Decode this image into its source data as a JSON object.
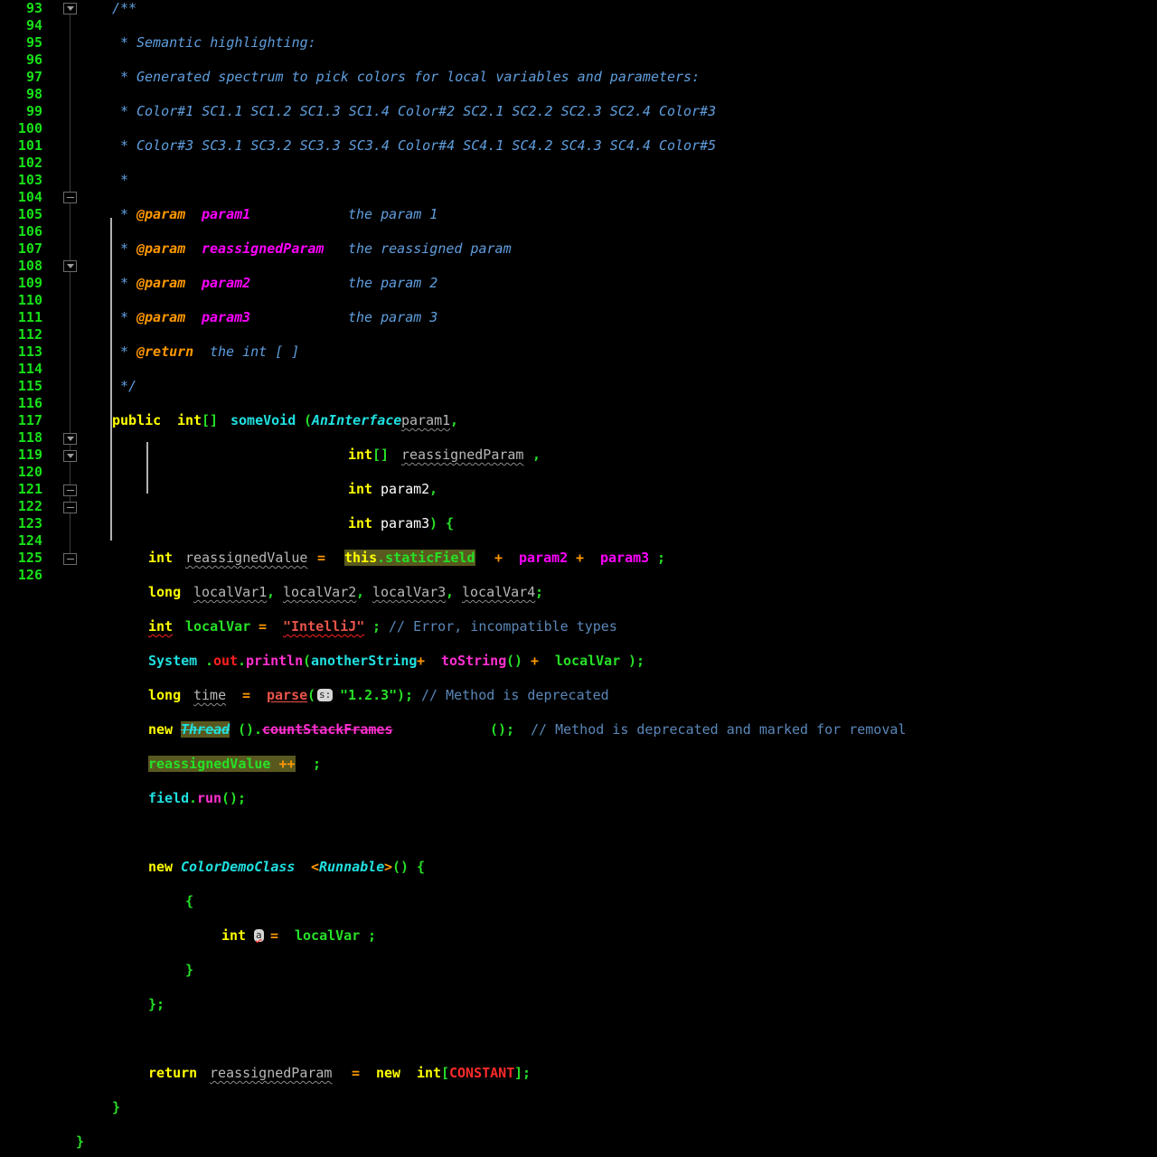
{
  "editor": {
    "language": "java",
    "theme": "dark-high-contrast",
    "first_line": 93,
    "last_line": 126,
    "colors": {
      "background": "#000000",
      "line_number": "#18e018",
      "keyword": "#ffff00",
      "comment": "#5f9ede",
      "string": "#26e026",
      "class_name": "#20e0e0",
      "method_call": "#ff30d0",
      "parameter": "#ff00ff",
      "static_field": "#26e026",
      "constant": "#ff2a2a",
      "operator": "#ff9800",
      "local_var_unused": "#b8b8b8",
      "highlight_background": "#59591f",
      "inlay_hint_background": "#d6d6d6"
    }
  },
  "gutter": {
    "line_numbers": [
      93,
      94,
      95,
      96,
      97,
      98,
      99,
      100,
      101,
      102,
      103,
      104,
      105,
      106,
      107,
      108,
      109,
      110,
      111,
      112,
      113,
      114,
      115,
      116,
      117,
      118,
      119,
      120,
      121,
      122,
      123,
      124,
      125,
      126
    ],
    "fold_markers": [
      {
        "line": 93,
        "state": "open"
      },
      {
        "line": 104,
        "state": "collapse"
      },
      {
        "line": 108,
        "state": "open"
      },
      {
        "line": 118,
        "state": "open"
      },
      {
        "line": 119,
        "state": "open"
      },
      {
        "line": 121,
        "state": "collapse"
      },
      {
        "line": 122,
        "state": "collapse"
      },
      {
        "line": 125,
        "state": "collapse"
      }
    ]
  },
  "inlay_hints": [
    {
      "line": 113,
      "text": "s:"
    },
    {
      "line": 120,
      "text": "a"
    }
  ],
  "lines": {
    "l93": "/**",
    "l94": " * Semantic highlighting:",
    "l95": " * Generated spectrum to pick colors for local variables and parameters:",
    "l96": " * Color#1 SC1.1 SC1.2 SC1.3 SC1.4 Color#2 SC2.1 SC2.2 SC2.3 SC2.4 Color#3",
    "l97": " * Color#3 SC3.1 SC3.2 SC3.3 SC3.4 Color#4 SC4.1 SC4.2 SC4.3 SC4.4 Color#5",
    "l98": " *",
    "l99": " * @param param1           the param 1",
    "l100": " * @param reassignedParam the reassigned param",
    "l101": " * @param param2           the param 2",
    "l102": " * @param param3           the param 3",
    "l103": " * @return the int [ ]",
    "l104": " */",
    "l105": "public int[] someVoid(AnInterface param1,",
    "l106": "                      int[] reassignedParam,",
    "l107": "                      int param2,",
    "l108": "                      int param3) {",
    "l109": "    int reassignedValue = this.staticField + param2 + param3;",
    "l110": "    long localVar1, localVar2, localVar3, localVar4;",
    "l111": "    int localVar = \"IntelliJ\"; // Error, incompatible types",
    "l112": "    System.out.println(anotherString + toString() + localVar);",
    "l113": "    long time = parse(s:\"1.2.3\"); // Method is deprecated",
    "l114": "    new Thread().countStackFrames(); // Method is deprecated and marked for removal",
    "l115": "    reassignedValue ++;",
    "l116": "    field.run();",
    "l117": "",
    "l118": "    new ColorDemoClass<Runnable>() {",
    "l119": "        {",
    "l120": "            int a = localVar;",
    "l121": "        }",
    "l122": "    };",
    "l123": "",
    "l124": "    return reassignedParam = new int[CONSTANT];",
    "l125": "  }",
    "l126": "}"
  },
  "tokens": {
    "comment_open": "/**",
    "comment_close": "*/",
    "star": "*",
    "semantic_title": "Semantic highlighting:",
    "spectrum_text": "Generated spectrum to pick colors for local variables and parameters:",
    "spectrum_row1": "Color#1 SC1.1 SC1.2 SC1.3 SC1.4 Color#2 SC2.1 SC2.2 SC2.3 SC2.4 Color#3",
    "spectrum_row2": "Color#3 SC3.1 SC3.2 SC3.3 SC3.4 Color#4 SC4.1 SC4.2 SC4.3 SC4.4 Color#5",
    "at_param": "@param",
    "at_return": "@return",
    "param1": "param1",
    "reassignedParam": "reassignedParam",
    "param2": "param2",
    "param3": "param3",
    "desc_param1": "the param 1",
    "desc_reassigned": "the reassigned param",
    "desc_param2": "the param 2",
    "desc_param3": "the param 3",
    "desc_return": "the int [ ]",
    "kw_public": "public",
    "kw_int": "int",
    "kw_long": "long",
    "kw_new": "new",
    "kw_this": "this",
    "kw_return": "return",
    "brackets": "[]",
    "someVoid": "someVoid",
    "AnInterface": "AnInterface",
    "reassignedValue": "reassignedValue",
    "staticField": "staticField",
    "localVar1": "localVar1",
    "localVar2": "localVar2",
    "localVar3": "localVar3",
    "localVar4": "localVar4",
    "localVar": "localVar",
    "str_intellij": "\"IntelliJ\"",
    "cmt_error": "// Error, incompatible types",
    "System": "System",
    "out": "out",
    "println": "println",
    "anotherString": "anotherString",
    "toString": "toString",
    "time": "time",
    "parse": "parse",
    "str_version": "\"1.2.3\"",
    "cmt_deprecated": "// Method is deprecated",
    "Thread": "Thread",
    "countStackFrames": "countStackFrames",
    "cmt_deprecated_removal": "// Method is deprecated and marked for removal",
    "plusplus": "++",
    "field": "field",
    "run": "run",
    "ColorDemoClass": "ColorDemoClass",
    "Runnable": "Runnable",
    "a": "a",
    "CONSTANT": "CONSTANT",
    "eq": "=",
    "plus": "+",
    "lt": "<",
    "gt": ">",
    "semi": ";",
    "comma": ",",
    "dot": ".",
    "paren_open": "(",
    "paren_close": ")",
    "parens": "()",
    "brace_open": "{",
    "brace_close": "}",
    "brace_close_semi": "};",
    "bracket_open": "[",
    "bracket_close": "]",
    "bracket_close_semi": "];"
  }
}
